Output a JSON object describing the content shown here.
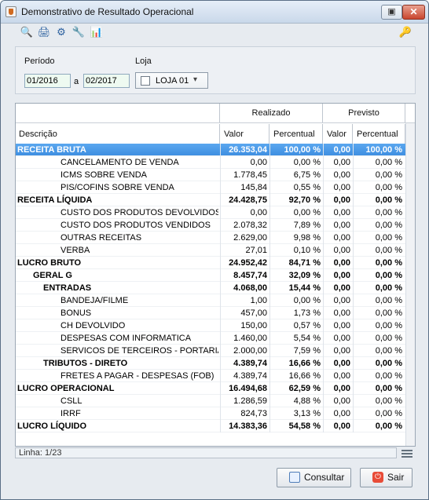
{
  "window": {
    "title": "Demonstrativo de Resultado Operacional",
    "restore_label": "▣",
    "close_label": "✕"
  },
  "toolbar": {
    "icons": [
      "document-search-icon",
      "print-icon",
      "settings-icon",
      "tools-icon",
      "chart-icon",
      "key-icon"
    ]
  },
  "filters": {
    "period_label": "Período",
    "start_date": "01/2016",
    "separator": "a",
    "end_date": "02/2017",
    "store_label": "Loja",
    "store_value": "LOJA 01"
  },
  "table": {
    "group_headers": {
      "realizado": "Realizado",
      "previsto": "Previsto"
    },
    "columns": {
      "description": "Descrição",
      "value": "Valor",
      "percent": "Percentual",
      "forecast_value": "Valor",
      "forecast_percent": "Percentual"
    },
    "rows": [
      {
        "description": "RECEITA BRUTA",
        "value": "26.353,04",
        "percent": "100,00 %",
        "forecast_value": "0,00",
        "forecast_percent": "100,00 %",
        "level": 0,
        "bold": true,
        "selected": true
      },
      {
        "description": "CANCELAMENTO DE VENDA",
        "value": "0,00",
        "percent": "0,00 %",
        "forecast_value": "0,00",
        "forecast_percent": "0,00 %",
        "level": 3
      },
      {
        "description": "ICMS SOBRE VENDA",
        "value": "1.778,45",
        "percent": "6,75 %",
        "forecast_value": "0,00",
        "forecast_percent": "0,00 %",
        "level": 3
      },
      {
        "description": "PIS/COFINS SOBRE VENDA",
        "value": "145,84",
        "percent": "0,55 %",
        "forecast_value": "0,00",
        "forecast_percent": "0,00 %",
        "level": 3
      },
      {
        "description": "RECEITA LÍQUIDA",
        "value": "24.428,75",
        "percent": "92,70 %",
        "forecast_value": "0,00",
        "forecast_percent": "0,00 %",
        "level": 0,
        "bold": true
      },
      {
        "description": "CUSTO DOS PRODUTOS DEVOLVIDOS",
        "value": "0,00",
        "percent": "0,00 %",
        "forecast_value": "0,00",
        "forecast_percent": "0,00 %",
        "level": 3
      },
      {
        "description": "CUSTO DOS PRODUTOS VENDIDOS",
        "value": "2.078,32",
        "percent": "7,89 %",
        "forecast_value": "0,00",
        "forecast_percent": "0,00 %",
        "level": 3
      },
      {
        "description": "OUTRAS RECEITAS",
        "value": "2.629,00",
        "percent": "9,98 %",
        "forecast_value": "0,00",
        "forecast_percent": "0,00 %",
        "level": 3
      },
      {
        "description": "VERBA",
        "value": "27,01",
        "percent": "0,10 %",
        "forecast_value": "0,00",
        "forecast_percent": "0,00 %",
        "level": 3
      },
      {
        "description": "LUCRO BRUTO",
        "value": "24.952,42",
        "percent": "84,71 %",
        "forecast_value": "0,00",
        "forecast_percent": "0,00 %",
        "level": 0,
        "bold": true
      },
      {
        "description": "GERAL G",
        "value": "8.457,74",
        "percent": "32,09 %",
        "forecast_value": "0,00",
        "forecast_percent": "0,00 %",
        "level": 1,
        "bold": true
      },
      {
        "description": "ENTRADAS",
        "value": "4.068,00",
        "percent": "15,44 %",
        "forecast_value": "0,00",
        "forecast_percent": "0,00 %",
        "level": 2,
        "bold": true
      },
      {
        "description": "BANDEJA/FILME",
        "value": "1,00",
        "percent": "0,00 %",
        "forecast_value": "0,00",
        "forecast_percent": "0,00 %",
        "level": 3
      },
      {
        "description": "BONUS",
        "value": "457,00",
        "percent": "1,73 %",
        "forecast_value": "0,00",
        "forecast_percent": "0,00 %",
        "level": 3
      },
      {
        "description": "CH DEVOLVIDO",
        "value": "150,00",
        "percent": "0,57 %",
        "forecast_value": "0,00",
        "forecast_percent": "0,00 %",
        "level": 3
      },
      {
        "description": "DESPESAS COM INFORMATICA",
        "value": "1.460,00",
        "percent": "5,54 %",
        "forecast_value": "0,00",
        "forecast_percent": "0,00 %",
        "level": 3
      },
      {
        "description": "SERVICOS DE TERCEIROS - PORTARIA",
        "value": "2.000,00",
        "percent": "7,59 %",
        "forecast_value": "0,00",
        "forecast_percent": "0,00 %",
        "level": 3
      },
      {
        "description": "TRIBUTOS - DIRETO",
        "value": "4.389,74",
        "percent": "16,66 %",
        "forecast_value": "0,00",
        "forecast_percent": "0,00 %",
        "level": 2,
        "bold": true
      },
      {
        "description": "FRETES A PAGAR - DESPESAS (FOB)",
        "value": "4.389,74",
        "percent": "16,66 %",
        "forecast_value": "0,00",
        "forecast_percent": "0,00 %",
        "level": 3
      },
      {
        "description": "LUCRO OPERACIONAL",
        "value": "16.494,68",
        "percent": "62,59 %",
        "forecast_value": "0,00",
        "forecast_percent": "0,00 %",
        "level": 0,
        "bold": true
      },
      {
        "description": "CSLL",
        "value": "1.286,59",
        "percent": "4,88 %",
        "forecast_value": "0,00",
        "forecast_percent": "0,00 %",
        "level": 3
      },
      {
        "description": "IRRF",
        "value": "824,73",
        "percent": "3,13 %",
        "forecast_value": "0,00",
        "forecast_percent": "0,00 %",
        "level": 3
      },
      {
        "description": "LUCRO LÍQUIDO",
        "value": "14.383,36",
        "percent": "54,58 %",
        "forecast_value": "0,00",
        "forecast_percent": "0,00 %",
        "level": 0,
        "bold": true
      }
    ]
  },
  "status": {
    "text": "Linha: 1/23"
  },
  "buttons": {
    "consultar": "Consultar",
    "sair": "Sair"
  }
}
